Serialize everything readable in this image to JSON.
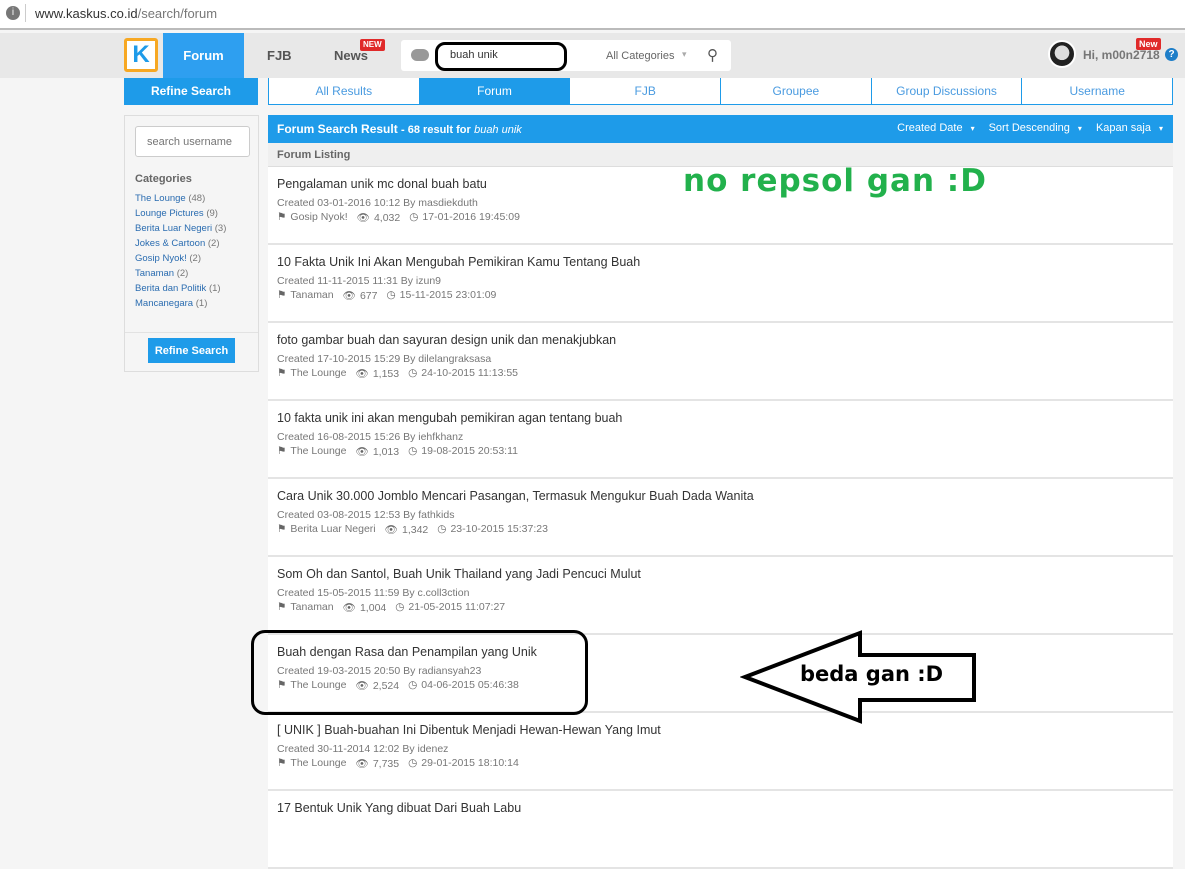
{
  "browser": {
    "url_domain": "www.kaskus.co.id",
    "url_path": "/search/forum"
  },
  "header": {
    "logo": "K",
    "nav": [
      {
        "label": "Forum",
        "active": true
      },
      {
        "label": "FJB"
      },
      {
        "label": "News",
        "badge": "NEW"
      }
    ],
    "search": {
      "query": "buah unik",
      "category": "All Categories"
    },
    "user": {
      "greeting": "Hi, m00n2718",
      "badge": "New"
    },
    "help": "?"
  },
  "refine_tab": "Refine Search",
  "tabs": [
    {
      "label": "All Results"
    },
    {
      "label": "Forum",
      "active": true
    },
    {
      "label": "FJB"
    },
    {
      "label": "Groupee"
    },
    {
      "label": "Group Discussions"
    },
    {
      "label": "Username"
    }
  ],
  "sidebar": {
    "username_placeholder": "search username",
    "categories_title": "Categories",
    "categories": [
      {
        "name": "The Lounge",
        "count": "(48)"
      },
      {
        "name": "Lounge Pictures",
        "count": "(9)"
      },
      {
        "name": "Berita Luar Negeri",
        "count": "(3)"
      },
      {
        "name": "Jokes & Cartoon",
        "count": "(2)"
      },
      {
        "name": "Gosip Nyok!",
        "count": "(2)"
      },
      {
        "name": "Tanaman",
        "count": "(2)"
      },
      {
        "name": "Berita dan Politik",
        "count": "(1)"
      },
      {
        "name": "Mancanegara",
        "count": "(1)"
      }
    ],
    "refine_button": "Refine Search"
  },
  "results": {
    "title": "Forum Search Result",
    "summary": "- 68 result for",
    "query": "buah unik",
    "sorts": [
      "Created Date",
      "Sort Descending",
      "Kapan saja"
    ],
    "listing_label": "Forum Listing",
    "items": [
      {
        "title": "Pengalaman unik mc donal buah batu",
        "created": "Created 03-01-2016 10:12 By masdiekduth",
        "category": "Gosip Nyok!",
        "views": "4,032",
        "last": "17-01-2016 19:45:09"
      },
      {
        "title": "10 Fakta Unik Ini Akan Mengubah Pemikiran Kamu Tentang Buah",
        "created": "Created 11-11-2015 11:31 By izun9",
        "category": "Tanaman",
        "views": "677",
        "last": "15-11-2015 23:01:09"
      },
      {
        "title": "foto gambar buah dan sayuran design unik dan menakjubkan",
        "created": "Created 17-10-2015 15:29 By dilelangraksasa",
        "category": "The Lounge",
        "views": "1,153",
        "last": "24-10-2015 11:13:55"
      },
      {
        "title": "10 fakta unik ini akan mengubah pemikiran agan tentang buah",
        "created": "Created 16-08-2015 15:26 By iehfkhanz",
        "category": "The Lounge",
        "views": "1,013",
        "last": "19-08-2015 20:53:11"
      },
      {
        "title": "Cara Unik 30.000 Jomblo Mencari Pasangan, Termasuk Mengukur Buah Dada Wanita",
        "created": "Created 03-08-2015 12:53 By fathkids",
        "category": "Berita Luar Negeri",
        "views": "1,342",
        "last": "23-10-2015 15:37:23"
      },
      {
        "title": "Som Oh dan Santol, Buah Unik Thailand yang Jadi Pencuci Mulut",
        "created": "Created 15-05-2015 11:59 By c.coll3ction",
        "category": "Tanaman",
        "views": "1,004",
        "last": "21-05-2015 11:07:27"
      },
      {
        "title": "Buah dengan Rasa dan Penampilan yang Unik",
        "created": "Created 19-03-2015 20:50 By radiansyah23",
        "category": "The Lounge",
        "views": "2,524",
        "last": "04-06-2015 05:46:38"
      },
      {
        "title": "[ UNIK ] Buah-buahan Ini Dibentuk Menjadi Hewan-Hewan Yang Imut",
        "created": "Created 30-11-2014 12:02 By idenez",
        "category": "The Lounge",
        "views": "7,735",
        "last": "29-01-2015 18:10:14"
      },
      {
        "title": "17 Bentuk Unik Yang dibuat Dari Buah Labu"
      }
    ]
  },
  "annotations": {
    "green_text": "no repsol gan :D",
    "arrow_text": "beda gan :D",
    "green_color": "#22b14c"
  }
}
